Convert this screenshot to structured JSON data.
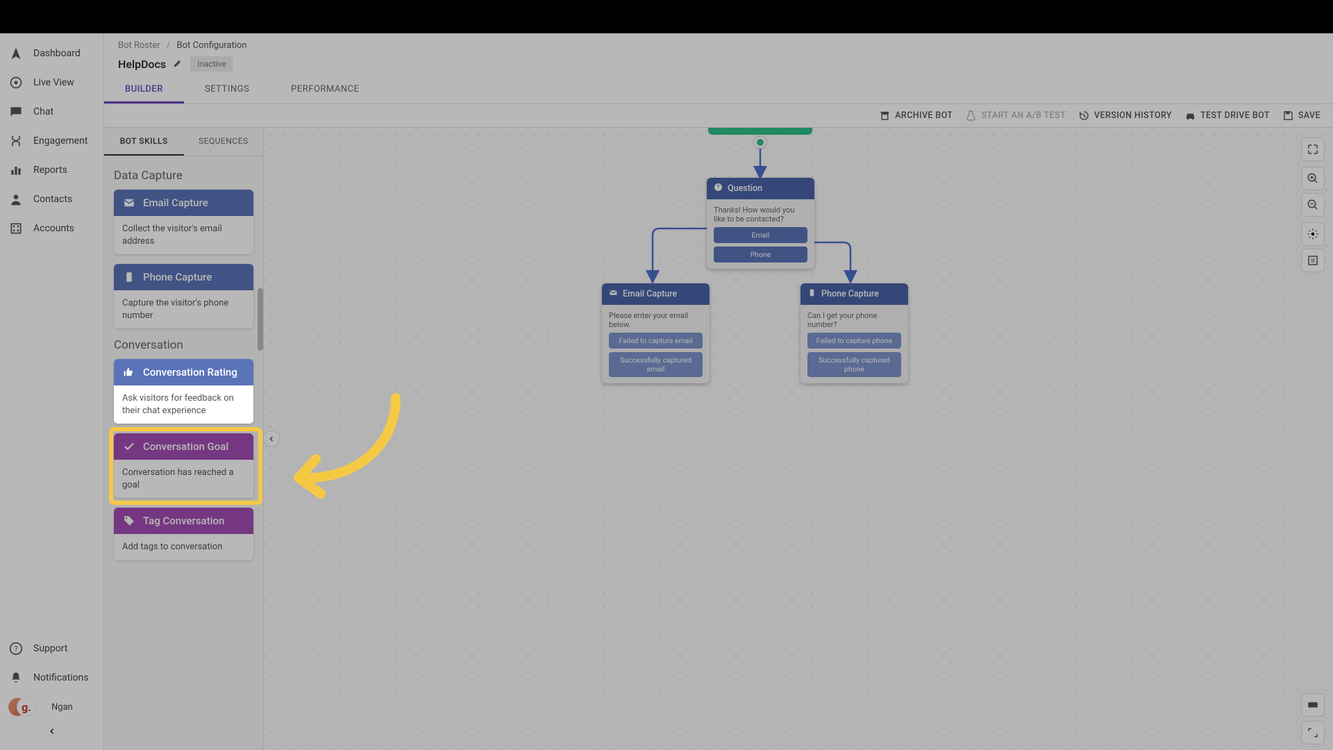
{
  "sidebar": {
    "items": [
      {
        "label": "Dashboard"
      },
      {
        "label": "Live View"
      },
      {
        "label": "Chat"
      },
      {
        "label": "Engagement"
      },
      {
        "label": "Reports"
      },
      {
        "label": "Contacts"
      },
      {
        "label": "Accounts"
      }
    ],
    "bottom": [
      {
        "label": "Support"
      },
      {
        "label": "Notifications"
      }
    ],
    "user_name": "Ngan",
    "g": "g."
  },
  "breadcrumb": {
    "root": "Bot Roster",
    "sep": "/",
    "current": "Bot Configuration"
  },
  "header": {
    "bot_name": "HelpDocs",
    "status": "Inactive"
  },
  "tabs": [
    {
      "label": "BUILDER",
      "active": true
    },
    {
      "label": "SETTINGS",
      "active": false
    },
    {
      "label": "PERFORMANCE",
      "active": false
    }
  ],
  "toolbar": {
    "archive": "ARCHIVE BOT",
    "ab": "START AN A/B TEST",
    "history": "VERSION HISTORY",
    "testdrive": "TEST DRIVE BOT",
    "save": "SAVE"
  },
  "skills_tabs": {
    "a": "BOT SKILLS",
    "b": "SEQUENCES"
  },
  "sections": {
    "data_capture": "Data Capture",
    "conversation": "Conversation"
  },
  "skills": {
    "email": {
      "title": "Email Capture",
      "desc": "Collect the visitor's email address"
    },
    "phone": {
      "title": "Phone Capture",
      "desc": "Capture the visitor's phone number"
    },
    "rating": {
      "title": "Conversation Rating",
      "desc": "Ask visitors for feedback on their chat experience"
    },
    "goal": {
      "title": "Conversation Goal",
      "desc": "Conversation has reached a goal"
    },
    "tag": {
      "title": "Tag Conversation",
      "desc": "Add tags to conversation"
    }
  },
  "nodes": {
    "question": {
      "title": "Question",
      "body": "Thanks! How would you like to be contacted?",
      "opt1": "Email",
      "opt2": "Phone"
    },
    "email": {
      "title": "Email Capture",
      "body": "Please enter your email below.",
      "opt1": "Failed to capture email",
      "opt2": "Successfully captured email"
    },
    "phone": {
      "title": "Phone Capture",
      "body": "Can I get your phone number?",
      "opt1": "Failed to capture phone",
      "opt2": "Successfully captured phone"
    }
  }
}
